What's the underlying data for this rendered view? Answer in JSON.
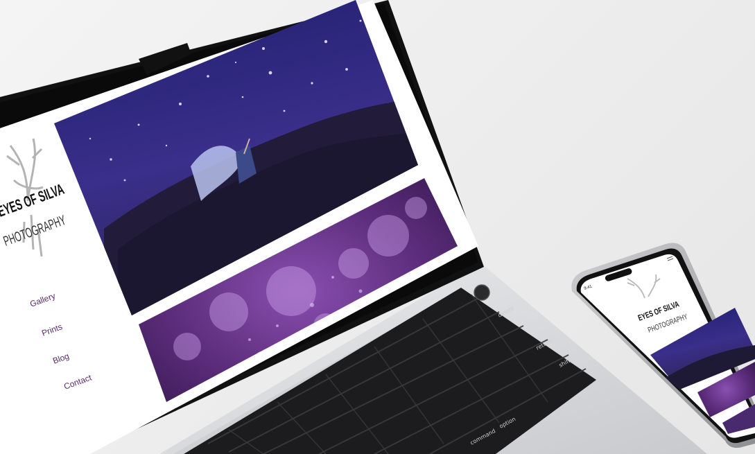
{
  "brand": {
    "line1": "EYES OF SILVA",
    "line2": "PHOTOGRAPHY"
  },
  "laptop": {
    "nav": [
      {
        "label": "Gallery"
      },
      {
        "label": "Prints"
      },
      {
        "label": "Blog"
      },
      {
        "label": "Contact"
      }
    ],
    "keyboard": {
      "keys": [
        "delete",
        "return",
        "shift",
        "option",
        "command"
      ]
    }
  },
  "phone": {
    "status_time": "9:41"
  },
  "colors": {
    "nav_text": "#5a2a6a",
    "night_sky": "#2c2573",
    "purple_bokeh": "#5b2c7a",
    "laptop_body": "#d9dadc",
    "bezel": "#111111"
  },
  "icons": {
    "logo": "antler-deer-icon",
    "menu": "hamburger-icon"
  }
}
